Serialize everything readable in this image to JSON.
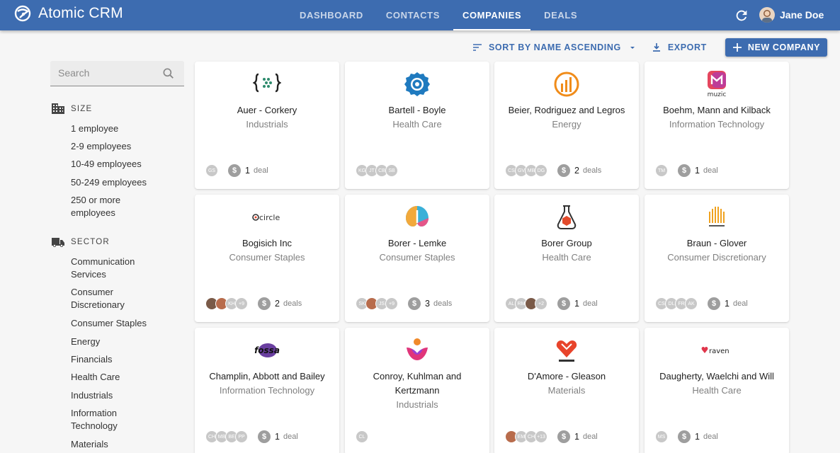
{
  "app": {
    "title": "Atomic CRM"
  },
  "nav": {
    "tabs": [
      "DASHBOARD",
      "CONTACTS",
      "COMPANIES",
      "DEALS"
    ],
    "active": "COMPANIES"
  },
  "user": {
    "name": "Jane Doe"
  },
  "toolbar": {
    "sort_label": "SORT BY NAME ASCENDING",
    "export_label": "EXPORT",
    "new_label": "NEW COMPANY"
  },
  "search": {
    "placeholder": "Search"
  },
  "filters": {
    "size": {
      "title": "SIZE",
      "items": [
        "1 employee",
        "2-9 employees",
        "10-49 employees",
        "50-249 employees",
        "250 or more employees"
      ]
    },
    "sector": {
      "title": "SECTOR",
      "items": [
        "Communication Services",
        "Consumer Discretionary",
        "Consumer Staples",
        "Energy",
        "Financials",
        "Health Care",
        "Industrials",
        "Information Technology",
        "Materials"
      ]
    }
  },
  "companies": [
    {
      "name": "Auer - Corkery",
      "sector": "Industrials",
      "contacts": [
        "GS"
      ],
      "deals": "1",
      "deal_word": "deal"
    },
    {
      "name": "Bartell - Boyle",
      "sector": "Health Care",
      "contacts": [
        "KG",
        "JT",
        "CB",
        "SB"
      ],
      "deals": "",
      "deal_word": ""
    },
    {
      "name": "Beier, Rodriguez and Legros",
      "sector": "Energy",
      "contacts": [
        "CS",
        "GV",
        "MB",
        "DG"
      ],
      "deals": "2",
      "deal_word": "deals"
    },
    {
      "name": "Boehm, Mann and Kilback",
      "sector": "Information Technology",
      "contacts": [
        "TM"
      ],
      "deals": "1",
      "deal_word": "deal"
    },
    {
      "name": "Bogisich Inc",
      "sector": "Consumer Staples",
      "contacts": [
        "",
        "",
        "KH",
        "+9"
      ],
      "deals": "2",
      "deal_word": "deals"
    },
    {
      "name": "Borer - Lemke",
      "sector": "Consumer Staples",
      "contacts": [
        "SK",
        "",
        "JS",
        "+9"
      ],
      "deals": "3",
      "deal_word": "deals"
    },
    {
      "name": "Borer Group",
      "sector": "Health Care",
      "contacts": [
        "AL",
        "RM",
        "",
        "+2"
      ],
      "deals": "1",
      "deal_word": "deal"
    },
    {
      "name": "Braun - Glover",
      "sector": "Consumer Discretionary",
      "contacts": [
        "CS",
        "DL",
        "FR",
        "AK"
      ],
      "deals": "1",
      "deal_word": "deal"
    },
    {
      "name": "Champlin, Abbott and Bailey",
      "sector": "Information Technology",
      "contacts": [
        "CH",
        "MB",
        "BE",
        "PP"
      ],
      "deals": "1",
      "deal_word": "deal"
    },
    {
      "name": "Conroy, Kuhlman and Kertzmann",
      "sector": "Industrials",
      "contacts": [
        "CL"
      ],
      "deals": "",
      "deal_word": ""
    },
    {
      "name": "D'Amore - Gleason",
      "sector": "Materials",
      "contacts": [
        "",
        "EM",
        "CH",
        "+13"
      ],
      "deals": "1",
      "deal_word": "deal"
    },
    {
      "name": "Daugherty, Waelchi and Will",
      "sector": "Health Care",
      "contacts": [
        "MS"
      ],
      "deals": "1",
      "deal_word": "deal"
    }
  ],
  "logo_text": {
    "circle": "circle",
    "muzic": "muzic",
    "fossa": "fossa",
    "raven": "raven"
  },
  "colors": {
    "primary": "#3d6cb0",
    "background": "#f6f6f6"
  }
}
